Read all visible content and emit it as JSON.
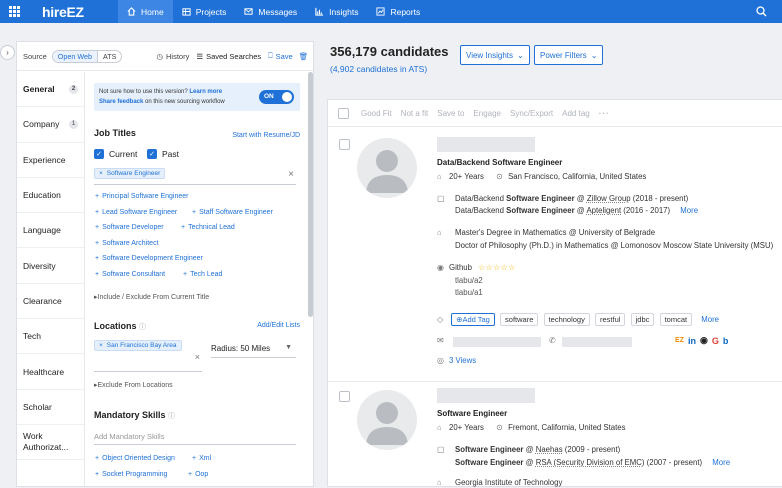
{
  "header": {
    "logo": "hireEZ",
    "nav": [
      {
        "label": "Home",
        "icon": "home-icon",
        "active": true
      },
      {
        "label": "Projects",
        "icon": "projects-icon"
      },
      {
        "label": "Messages",
        "icon": "mail-icon"
      },
      {
        "label": "Insights",
        "icon": "bar-chart-icon"
      },
      {
        "label": "Reports",
        "icon": "trend-icon"
      }
    ]
  },
  "sourcebar": {
    "source_label": "Source",
    "open_web": "Open Web",
    "ats": "ATS",
    "history": "History",
    "saved_searches": "Saved Searches",
    "save": "Save"
  },
  "categories": [
    {
      "label": "General",
      "badge": "2",
      "active": true
    },
    {
      "label": "Company",
      "badge": "1"
    },
    {
      "label": "Experience"
    },
    {
      "label": "Education"
    },
    {
      "label": "Language"
    },
    {
      "label": "Diversity"
    },
    {
      "label": "Clearance"
    },
    {
      "label": "Tech"
    },
    {
      "label": "Healthcare"
    },
    {
      "label": "Scholar"
    },
    {
      "label": "Work Authorizat..."
    }
  ],
  "notice": {
    "text1": "Not sure how to use this version?",
    "link1": "Learn more",
    "link2": "Share feedback",
    "text2": "on this new sourcing workflow",
    "toggle": "ON"
  },
  "job_titles": {
    "heading": "Job Titles",
    "resume_link": "Start with Resume/JD",
    "current": "Current",
    "past": "Past",
    "chip": "Software Engineer",
    "suggestions": [
      [
        "Principal Software Engineer"
      ],
      [
        "Lead Software Engineer",
        "Staff Software Engineer"
      ],
      [
        "Software Developer",
        "Technical Lead"
      ],
      [
        "Software Architect"
      ],
      [
        "Software Development Engineer"
      ],
      [
        "Software Consultant",
        "Tech Lead"
      ]
    ],
    "include_exclude": "Include / Exclude From Current Title"
  },
  "locations": {
    "heading": "Locations",
    "edit_link": "Add/Edit Lists",
    "chip": "San Francisco Bay Area",
    "radius": "Radius: 50 Miles",
    "exclude": "Exclude From Locations"
  },
  "mandatory_skills": {
    "heading": "Mandatory Skills",
    "placeholder": "Add Mandatory Skills",
    "suggestions": [
      [
        "Object Oriented Design",
        "Xml"
      ],
      [
        "Socket Programming",
        "Oop"
      ]
    ]
  },
  "results_header": {
    "count": "356,179 candidates",
    "ats_count": "(4,902 candidates in ATS)",
    "view_insights": "View Insights",
    "power_filters": "Power Filters"
  },
  "actions": [
    "Good Fit",
    "Not a fit",
    "Save to",
    "Engage",
    "Sync/Export",
    "Add tag"
  ],
  "candidates": [
    {
      "title": "Data/Backend Software Engineer",
      "years": "20+ Years",
      "location": "San Francisco, California, United States",
      "exp": [
        {
          "role": "Data/Backend ",
          "bold": "Software Engineer",
          "at": " @ ",
          "company": "Zillow Group",
          "dates": " (2018 - present)"
        },
        {
          "role": "Data/Backend ",
          "bold": "Software Engineer",
          "at": " @ ",
          "company": "Apteligent",
          "dates": " (2016 - 2017)",
          "more": "More"
        }
      ],
      "edu": [
        "Master's Degree in Mathematics @ University of Belgrade",
        "Doctor of Philosophy (Ph.D.) in Mathematics @ Lomonosov Moscow State University (MSU)"
      ],
      "github": "Github",
      "github_handles": [
        "tlabu/a2",
        "tlabu/a1"
      ],
      "add_tag": "Add Tag",
      "skills": [
        "software",
        "technology",
        "restful",
        "jdbc",
        "tomcat"
      ],
      "skills_more": "More",
      "views": "3 Views"
    },
    {
      "title": "Software Engineer",
      "years": "20+ Years",
      "location": "Fremont, California, United States",
      "exp": [
        {
          "role": "",
          "bold": "Software Engineer",
          "at": " @ ",
          "company": "Naehas",
          "dates": " (2009 - present)"
        },
        {
          "role": "",
          "bold": "Software Engineer",
          "at": " @ ",
          "company": "RSA (Security Division of EMC)",
          "dates": " (2007 - present)",
          "more": "More"
        }
      ],
      "edu": [
        "Georgia Institute of Technology"
      ]
    }
  ],
  "colors": {
    "brand": "#1f70d7",
    "linkedin": "#0a66c2",
    "google": "#db4437"
  }
}
